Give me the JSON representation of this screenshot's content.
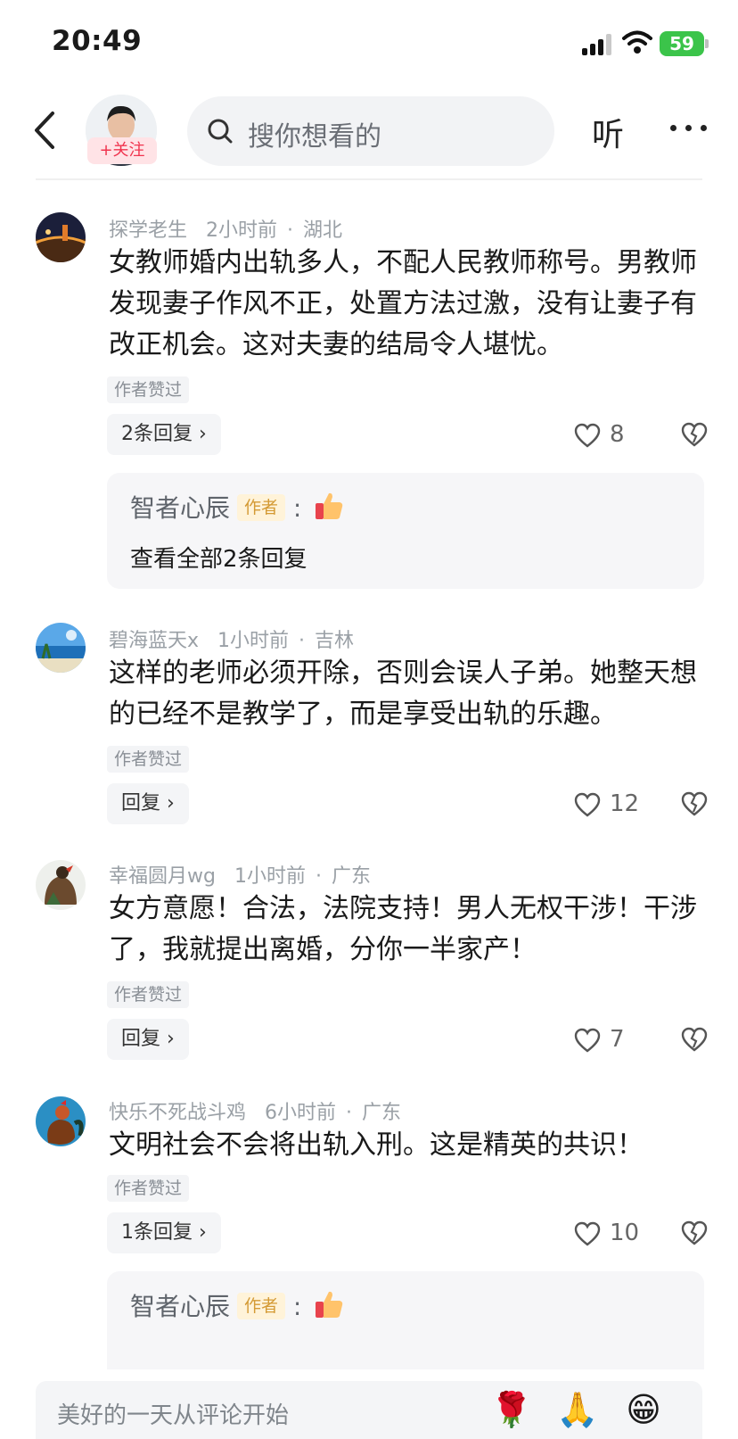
{
  "status_bar": {
    "time": "20:49",
    "battery": "59"
  },
  "top_nav": {
    "follow_label": "+关注",
    "search_placeholder": "搜你想看的",
    "listen_label": "听"
  },
  "comments": [
    {
      "user": "探学老生",
      "time": "2小时前",
      "location": "湖北",
      "body": "女教师婚内出轨多人，不配人民教师称号。男教师发现妻子作风不正，处置方法过激，没有让妻子有改正机会。这对夫妻的结局令人堪忧。",
      "author_liked": "作者赞过",
      "reply_label": "2条回复 ›",
      "likes": "8",
      "reply_preview": {
        "user": "智者心辰",
        "tag": "作者",
        "view_all": "查看全部2条回复"
      }
    },
    {
      "user": "碧海蓝天x",
      "time": "1小时前",
      "location": "吉林",
      "body": "这样的老师必须开除，否则会误人子弟。她整天想的已经不是教学了，而是享受出轨的乐趣。",
      "author_liked": "作者赞过",
      "reply_label": "回复 ›",
      "likes": "12"
    },
    {
      "user": "幸福圆月wg",
      "time": "1小时前",
      "location": "广东",
      "body": "女方意愿！合法，法院支持！男人无权干涉！干涉了，我就提出离婚，分你一半家产！",
      "author_liked": "作者赞过",
      "reply_label": "回复 ›",
      "likes": "7"
    },
    {
      "user": "快乐不死战斗鸡",
      "time": "6小时前",
      "location": "广东",
      "body": "文明社会不会将出轨入刑。这是精英的共识！",
      "author_liked": "作者赞过",
      "reply_label": "1条回复 ›",
      "likes": "10",
      "reply_preview": {
        "user": "智者心辰",
        "tag": "作者"
      }
    }
  ],
  "bottom_bar": {
    "placeholder": "美好的一天从评论开始",
    "emojis": [
      "🌹",
      "🙏",
      "😁"
    ]
  },
  "colors": {
    "accent_red": "#f0344e",
    "battery_green": "#3bc44a",
    "author_tag": "#d49a34"
  },
  "icons": [
    "back-icon",
    "search-icon",
    "more-icon",
    "heart-icon",
    "broken-heart-icon",
    "thumbs-up-icon"
  ]
}
